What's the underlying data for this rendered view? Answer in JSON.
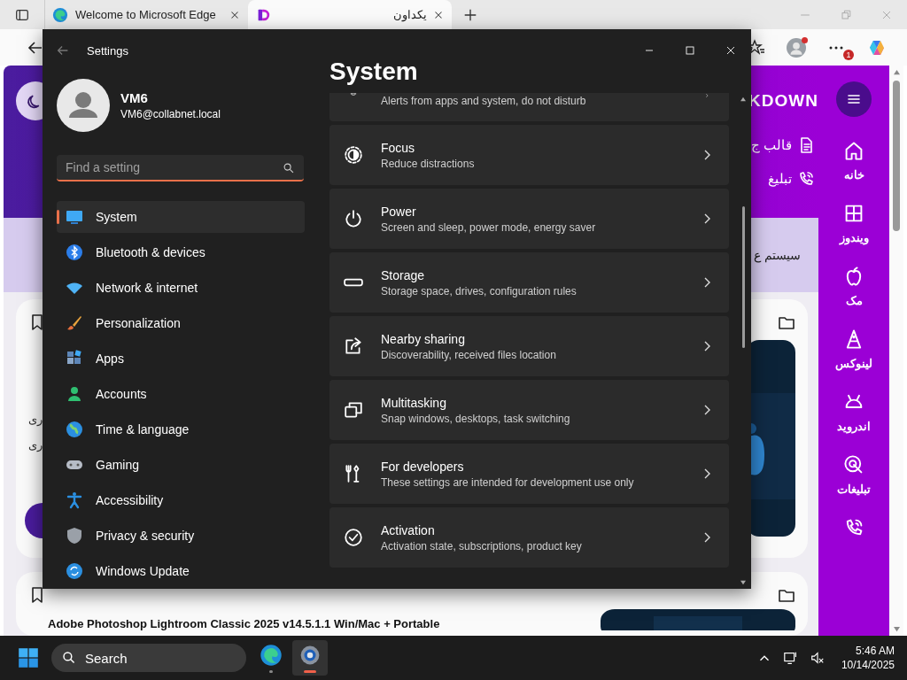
{
  "browser": {
    "tabs": [
      {
        "title": "Welcome to Microsoft Edge",
        "selected": false
      },
      {
        "title": "یکداون",
        "selected": true
      }
    ],
    "more_badge": "1"
  },
  "webpage": {
    "logo": "KDOWN",
    "header_links": [
      {
        "label": "قالب ج"
      },
      {
        "label": "تبلیغ"
      }
    ],
    "banner_text": "سیستم ع",
    "side_texts": [
      "ری",
      "ری"
    ],
    "post_title": "Adobe Photoshop Lightroom Classic 2025 v14.5.1.1 Win/Mac + Portable",
    "nav": [
      {
        "label": "خانه"
      },
      {
        "label": "ویندوز"
      },
      {
        "label": "مک"
      },
      {
        "label": "لینوکس"
      },
      {
        "label": "اندروید"
      },
      {
        "label": "تبلیغات"
      }
    ]
  },
  "settings": {
    "title": "Settings",
    "user": {
      "name": "VM6",
      "email": "VM6@collabnet.local"
    },
    "search": {
      "placeholder": "Find a setting"
    },
    "nav": [
      {
        "label": "System",
        "selected": true
      },
      {
        "label": "Bluetooth & devices",
        "selected": false
      },
      {
        "label": "Network & internet",
        "selected": false
      },
      {
        "label": "Personalization",
        "selected": false
      },
      {
        "label": "Apps",
        "selected": false
      },
      {
        "label": "Accounts",
        "selected": false
      },
      {
        "label": "Time & language",
        "selected": false
      },
      {
        "label": "Gaming",
        "selected": false
      },
      {
        "label": "Accessibility",
        "selected": false
      },
      {
        "label": "Privacy & security",
        "selected": false
      },
      {
        "label": "Windows Update",
        "selected": false
      }
    ],
    "heading": "System",
    "items": [
      {
        "subtitle": "Alerts from apps and system, do not disturb"
      },
      {
        "title": "Focus",
        "subtitle": "Reduce distractions"
      },
      {
        "title": "Power",
        "subtitle": "Screen and sleep, power mode, energy saver"
      },
      {
        "title": "Storage",
        "subtitle": "Storage space, drives, configuration rules"
      },
      {
        "title": "Nearby sharing",
        "subtitle": "Discoverability, received files location"
      },
      {
        "title": "Multitasking",
        "subtitle": "Snap windows, desktops, task switching"
      },
      {
        "title": "For developers",
        "subtitle": "These settings are intended for development use only"
      },
      {
        "title": "Activation",
        "subtitle": "Activation state, subscriptions, product key"
      }
    ]
  },
  "taskbar": {
    "search": "Search",
    "apps": [
      {
        "selected": false
      },
      {
        "selected": true
      }
    ],
    "time": "5:46 AM",
    "date": "10/14/2025"
  }
}
